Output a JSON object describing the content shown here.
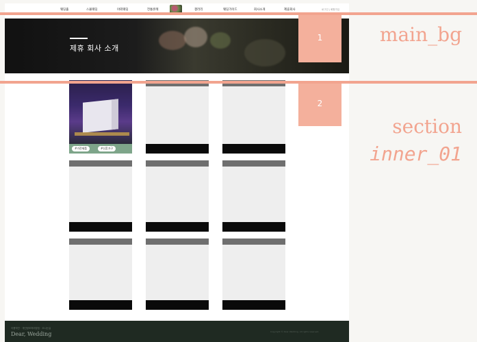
{
  "nav": {
    "items": [
      "웨딩홀",
      "스몰웨딩",
      "야외웨딩",
      "전통혼례",
      "갤러리",
      "웨딩가이드",
      "회사소개",
      "제휴회사"
    ],
    "util": "로그인 | 회원가입"
  },
  "hero": {
    "title": "제휴 회사 소개"
  },
  "partners": {
    "featured_tags": [
      "#가전제품",
      "#신혼가구"
    ]
  },
  "footer": {
    "small_text": "이용약관 · 개인정보처리방침 · 오시는길",
    "brand": "Dear, Wedding",
    "copyright": "Copyright © Dear Wedding. All rights reserved."
  },
  "annotations": {
    "badge1": "1",
    "badge2": "2",
    "label_main_bg": "main_bg",
    "label_section": "section",
    "label_inner": "inner_01"
  },
  "colors": {
    "accent": "#f2a48f",
    "badge": "#f4b09c",
    "footer_bg": "#1f2a22",
    "card_bg": "#eeeeee"
  }
}
